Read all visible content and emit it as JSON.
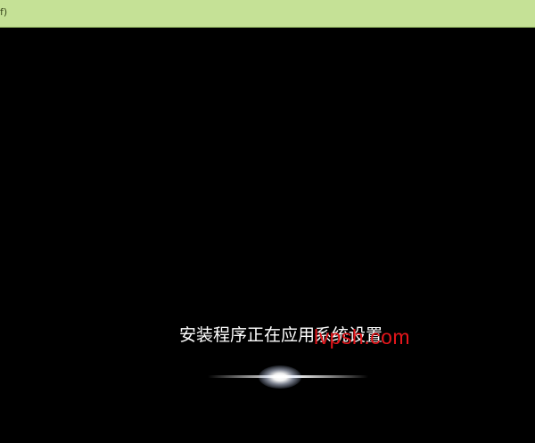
{
  "header": {
    "fragment_text": "f)",
    "background_color": "#c5e196"
  },
  "setup": {
    "status_text": "安装程序正在应用系统设置",
    "indicator_icon": "loading-glow-icon"
  },
  "watermark": {
    "text": "lvpsh.com",
    "color": "#e4161b"
  }
}
